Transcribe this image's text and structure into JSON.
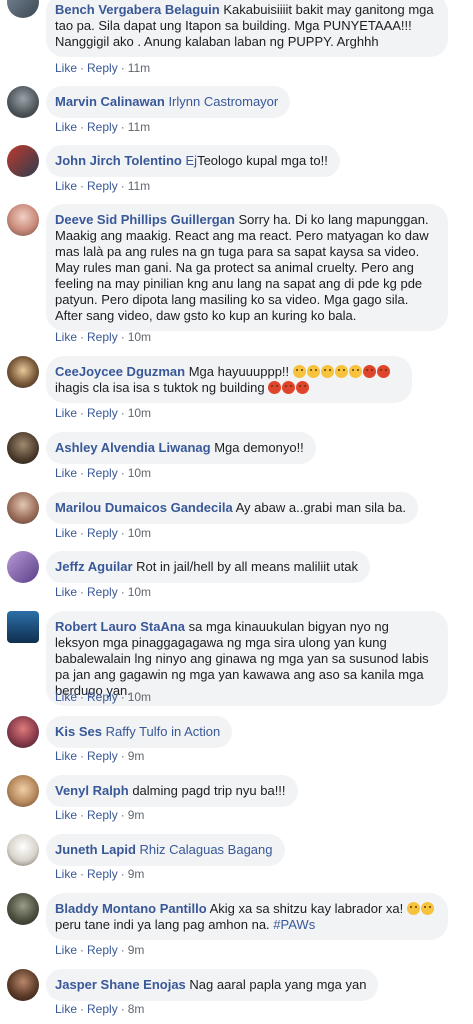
{
  "actions": {
    "like": "Like",
    "reply": "Reply",
    "sep": "·"
  },
  "comments": [
    {
      "author": "Bench Vergabera Belaguin",
      "text": "Kakabuisiiiit bakit may ganitong mga tao pa. Sila dapat ung Itapon sa building. Mga PUNYETAAA!!! Nanggigil ako . Anung kalaban laban ng PUPPY. Arghhh",
      "time": "11m"
    },
    {
      "author": "Marvin Calinawan",
      "mention": "Irlynn Castromayor",
      "text": "",
      "time": "11m"
    },
    {
      "author": "John Jirch Tolentino",
      "mention": "Ej",
      "text": "Teologo kupal mga to!!",
      "time": "11m"
    },
    {
      "author": "Deeve Sid Phillips Guillergan",
      "text": "Sorry ha. Di ko lang mapunggan. Maakig ang maakig. React ang ma react. Pero matyagan ko daw mas lalà pa ang rules na gn tuga para sa sapat kaysa sa video. May rules man gani. Na ga protect sa animal cruelty. Pero ang feeling na may pinilian kng anu lang na sapat ang di pde kg pde patyun. Pero dipota lang masiling ko sa video. Mga gago sila. After sang video, daw gsto ko kup an kuring ko bala.",
      "time": "10m"
    },
    {
      "author": "CeeJoycee Dguzman",
      "text": "Mga hayuuuppp!!",
      "text2": "ihagis cla isa isa s tuktok ng building",
      "time": "10m"
    },
    {
      "author": "Ashley Alvendia Liwanag",
      "text": "Mga demonyo!!",
      "time": "10m"
    },
    {
      "author": "Marilou Dumaicos Gandecila",
      "text": "Ay abaw a..grabi man sila ba.",
      "time": "10m"
    },
    {
      "author": "Jeffz Aguilar",
      "text": "Rot in jail/hell by all means maliliit utak",
      "time": "10m"
    },
    {
      "author": "Robert Lauro StaAna",
      "text": "sa mga kinauukulan bigyan nyo ng leksyon mga pinaggagagawa ng mga sira ulong yan kung babalewalain lng ninyo ang ginawa ng mga yan sa susunod labis pa jan ang gagawin ng mga yan kawawa ang aso sa kanila mga berdugo yan.",
      "time": "10m"
    },
    {
      "author": "Kis Ses",
      "mention": "Raffy Tulfo in Action",
      "text": "",
      "time": "9m"
    },
    {
      "author": "Venyl Ralph",
      "text": "dalming pagd trip nyu ba!!!",
      "time": "9m"
    },
    {
      "author": "Juneth Lapid",
      "mention": "Rhiz Calaguas Bagang",
      "text": "",
      "time": "9m"
    },
    {
      "author": "Bladdy Montano Pantillo",
      "text": "Akig xa sa shitzu kay labrador xa!",
      "text2": "peru tane indi ya lang pag amhon na.",
      "hashtag": "#PAWs",
      "time": "9m"
    },
    {
      "author": "Jasper Shane Enojas",
      "text": "Nag aaral papla yang mga yan",
      "time": "8m"
    }
  ],
  "colors": {
    "link": "#385898",
    "bubble": "#f2f3f5",
    "meta": "#606770"
  }
}
